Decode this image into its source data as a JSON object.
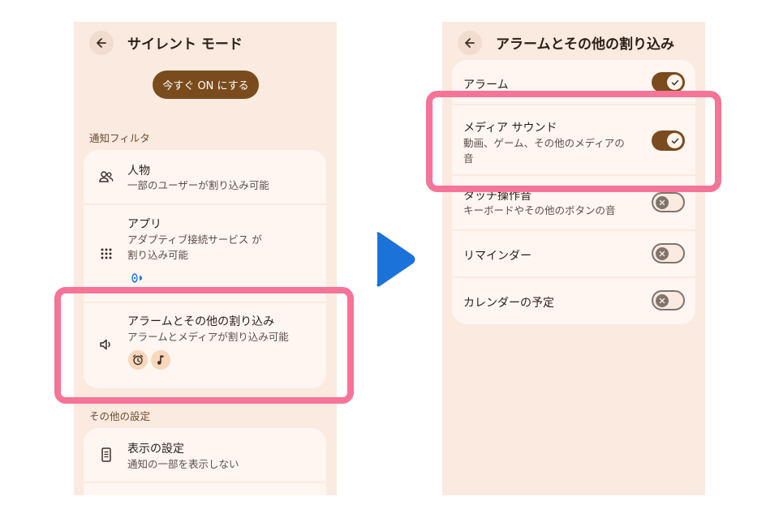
{
  "left_screen": {
    "title": "サイレント モード",
    "turn_on_button": "今すぐ ON にする",
    "section_notification_filter": "通知フィルタ",
    "people": {
      "title": "人物",
      "subtitle": "一部のユーザーが割り込み可能",
      "icon": "people-icon"
    },
    "apps": {
      "title": "アプリ",
      "subtitle_line1": "アダプティブ接続サービス が",
      "subtitle_line2": "割り込み可能",
      "icon": "apps-grid-icon"
    },
    "alarms": {
      "title": "アラームとその他の割り込み",
      "subtitle": "アラームとメディアが割り込み可能",
      "icon": "volume-icon",
      "chips": [
        "alarm-clock-icon",
        "music-note-icon"
      ]
    },
    "section_other_settings": "その他の設定",
    "display": {
      "title": "表示の設定",
      "subtitle": "通知の一部を表示しない",
      "icon": "phone-icon"
    }
  },
  "right_screen": {
    "title": "アラームとその他の割り込み",
    "items": [
      {
        "title": "アラーム",
        "subtitle": "",
        "enabled": true
      },
      {
        "title": "メディア サウンド",
        "subtitle_line1": "動画、ゲーム、その他のメディアの",
        "subtitle_line2": "音",
        "enabled": true
      },
      {
        "title": "タッチ操作音",
        "subtitle": "キーボードやその他のボタンの音",
        "enabled": false
      },
      {
        "title": "リマインダー",
        "subtitle": "",
        "enabled": false
      },
      {
        "title": "カレンダーの予定",
        "subtitle": "",
        "enabled": false
      }
    ]
  },
  "colors": {
    "panel_bg": "#fbeae0",
    "card_bg": "#fff6f1",
    "accent_brown": "#7a4b1c",
    "highlight_pink": "#f57497",
    "arrow_blue": "#1b73d9"
  }
}
